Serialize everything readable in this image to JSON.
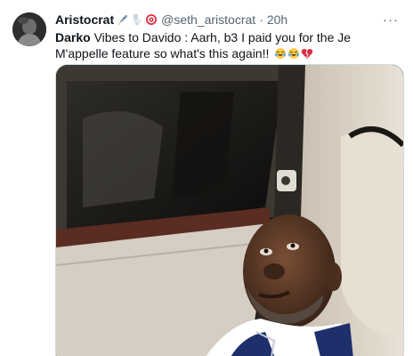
{
  "tweet": {
    "display_name": "Aristocrat",
    "name_emojis": [
      "rocket-emoji",
      "toilet-emoji",
      "target-emoji"
    ],
    "handle": "@seth_aristocrat",
    "separator": "·",
    "time": "20h",
    "more_label": "···",
    "text_bold": "Darko",
    "text_body": " Vibes to Davido : Aarh, b3 I paid you for the Je M'appelle feature so what's this again!! ",
    "text_emojis": [
      "crying-laughing-emoji",
      "crying-laughing-emoji",
      "broken-heart-emoji"
    ],
    "media_description": "photo-man-in-car-seat"
  },
  "colors": {
    "primary_text": "#0f1419",
    "secondary_text": "#536471",
    "border": "#cfd9de"
  }
}
